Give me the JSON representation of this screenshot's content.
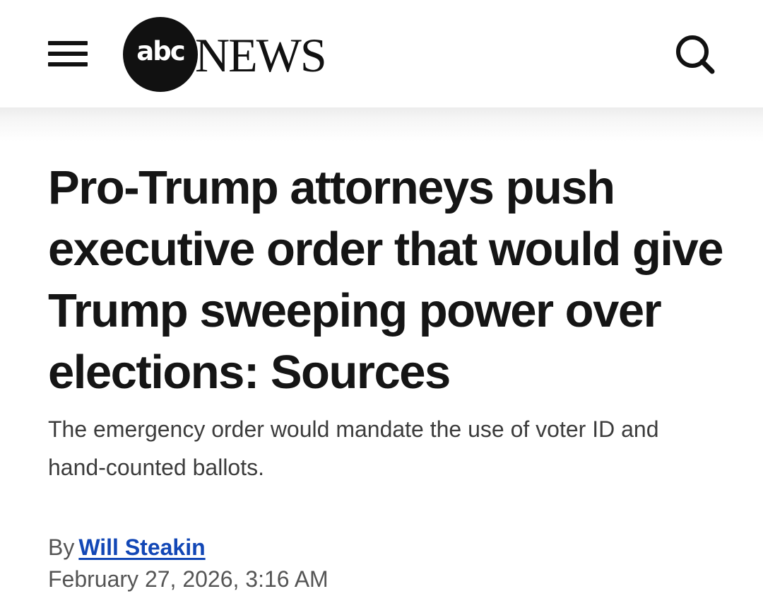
{
  "header": {
    "menu_icon": "hamburger-menu-icon",
    "logo": {
      "abc_text": "abc",
      "news_text": "NEWS"
    },
    "search_icon": "search-icon"
  },
  "article": {
    "headline": "Pro-Trump attorneys push executive order that would give Trump sweeping power over elections: Sources",
    "subheadline": "The emergency order would mandate the use of voter ID and hand-counted ballots.",
    "byline_prefix": "By",
    "author": "Will Steakin",
    "date": "February 27, 2026, 3:16 AM"
  },
  "colors": {
    "author_link": "#1247b6",
    "headline": "#151515",
    "logo": "#111111"
  }
}
